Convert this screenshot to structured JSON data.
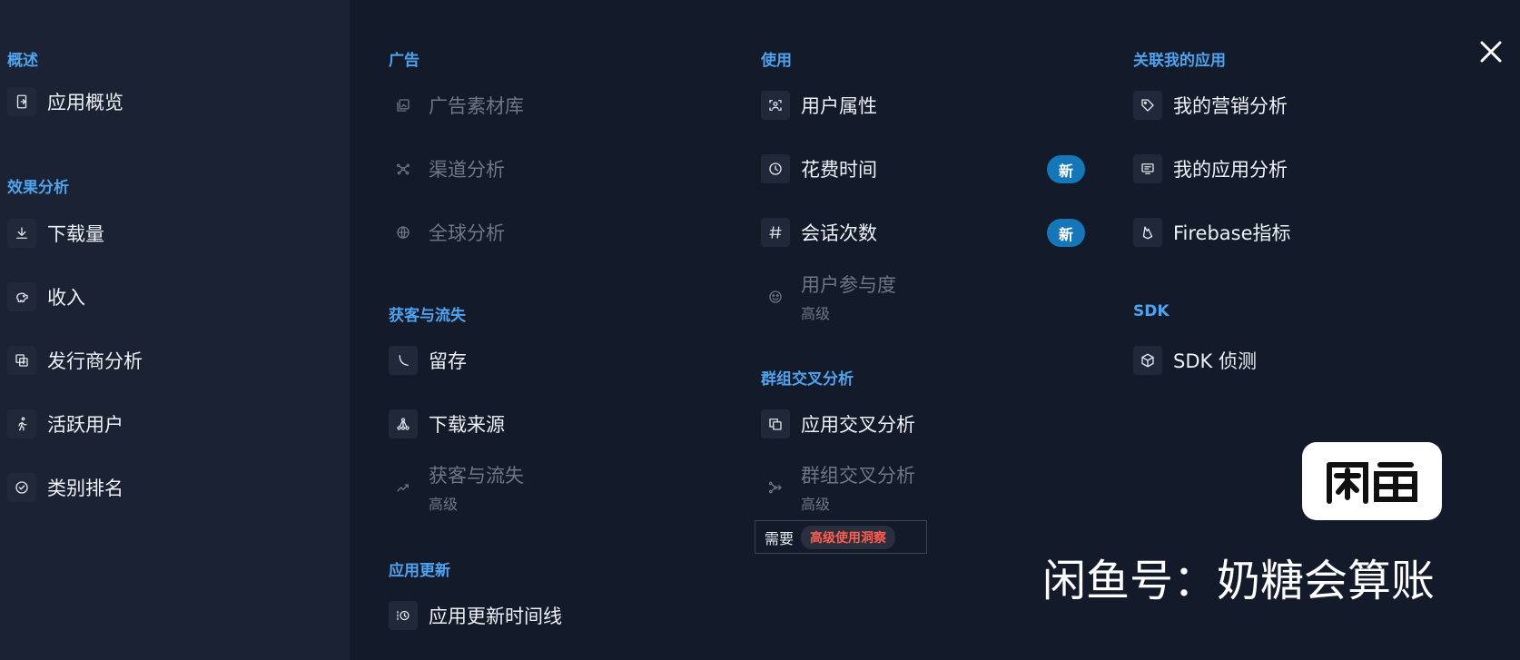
{
  "left": {
    "overview_title": "概述",
    "overview_items": [
      {
        "label": "应用概览",
        "icon": "app-overview-icon"
      }
    ],
    "effect_title": "效果分析",
    "effect_items": [
      {
        "label": "下载量",
        "icon": "download-icon"
      },
      {
        "label": "收入",
        "icon": "piggy-bank-icon"
      },
      {
        "label": "发行商分析",
        "icon": "publisher-icon"
      },
      {
        "label": "活跃用户",
        "icon": "running-person-icon"
      },
      {
        "label": "类别排名",
        "icon": "badge-check-icon"
      }
    ]
  },
  "ads": {
    "title": "广告",
    "items": [
      {
        "label": "广告素材库",
        "icon": "gallery-icon"
      },
      {
        "label": "渠道分析",
        "icon": "network-icon"
      },
      {
        "label": "全球分析",
        "icon": "globe-icon"
      }
    ]
  },
  "acquisition": {
    "title": "获客与流失",
    "items": [
      {
        "label": "留存",
        "icon": "retention-curve-icon"
      },
      {
        "label": "下载来源",
        "icon": "source-tree-icon"
      },
      {
        "label": "获客与流失",
        "sub": "高级",
        "icon": "trend-up-icon"
      }
    ]
  },
  "updates": {
    "title": "应用更新",
    "items": [
      {
        "label": "应用更新时间线",
        "icon": "history-clock-icon"
      }
    ]
  },
  "usage": {
    "title": "使用",
    "items": [
      {
        "label": "用户属性",
        "icon": "user-scan-icon"
      },
      {
        "label": "花费时间",
        "icon": "clock-icon",
        "badge": "新"
      },
      {
        "label": "会话次数",
        "icon": "hash-icon",
        "badge": "新"
      },
      {
        "label": "用户参与度",
        "sub": "高级",
        "icon": "face-icon"
      }
    ]
  },
  "cohort": {
    "title": "群组交叉分析",
    "items": [
      {
        "label": "应用交叉分析",
        "icon": "copy-icon"
      },
      {
        "label": "群组交叉分析",
        "sub": "高级",
        "icon": "merge-icon"
      }
    ],
    "requires_label": "需要",
    "requires_pill": "高级使用洞察"
  },
  "linked": {
    "title": "关联我的应用",
    "items": [
      {
        "label": "我的营销分析",
        "icon": "tag-icon"
      },
      {
        "label": "我的应用分析",
        "icon": "screen-chart-icon"
      },
      {
        "label": "Firebase指标",
        "icon": "firebase-icon"
      }
    ]
  },
  "sdk": {
    "title": "SDK",
    "items": [
      {
        "label": "SDK 侦测",
        "icon": "cube-icon"
      }
    ]
  },
  "watermark": {
    "logo_text": "闲鱼",
    "text": "闲鱼号：奶糖会算账"
  }
}
